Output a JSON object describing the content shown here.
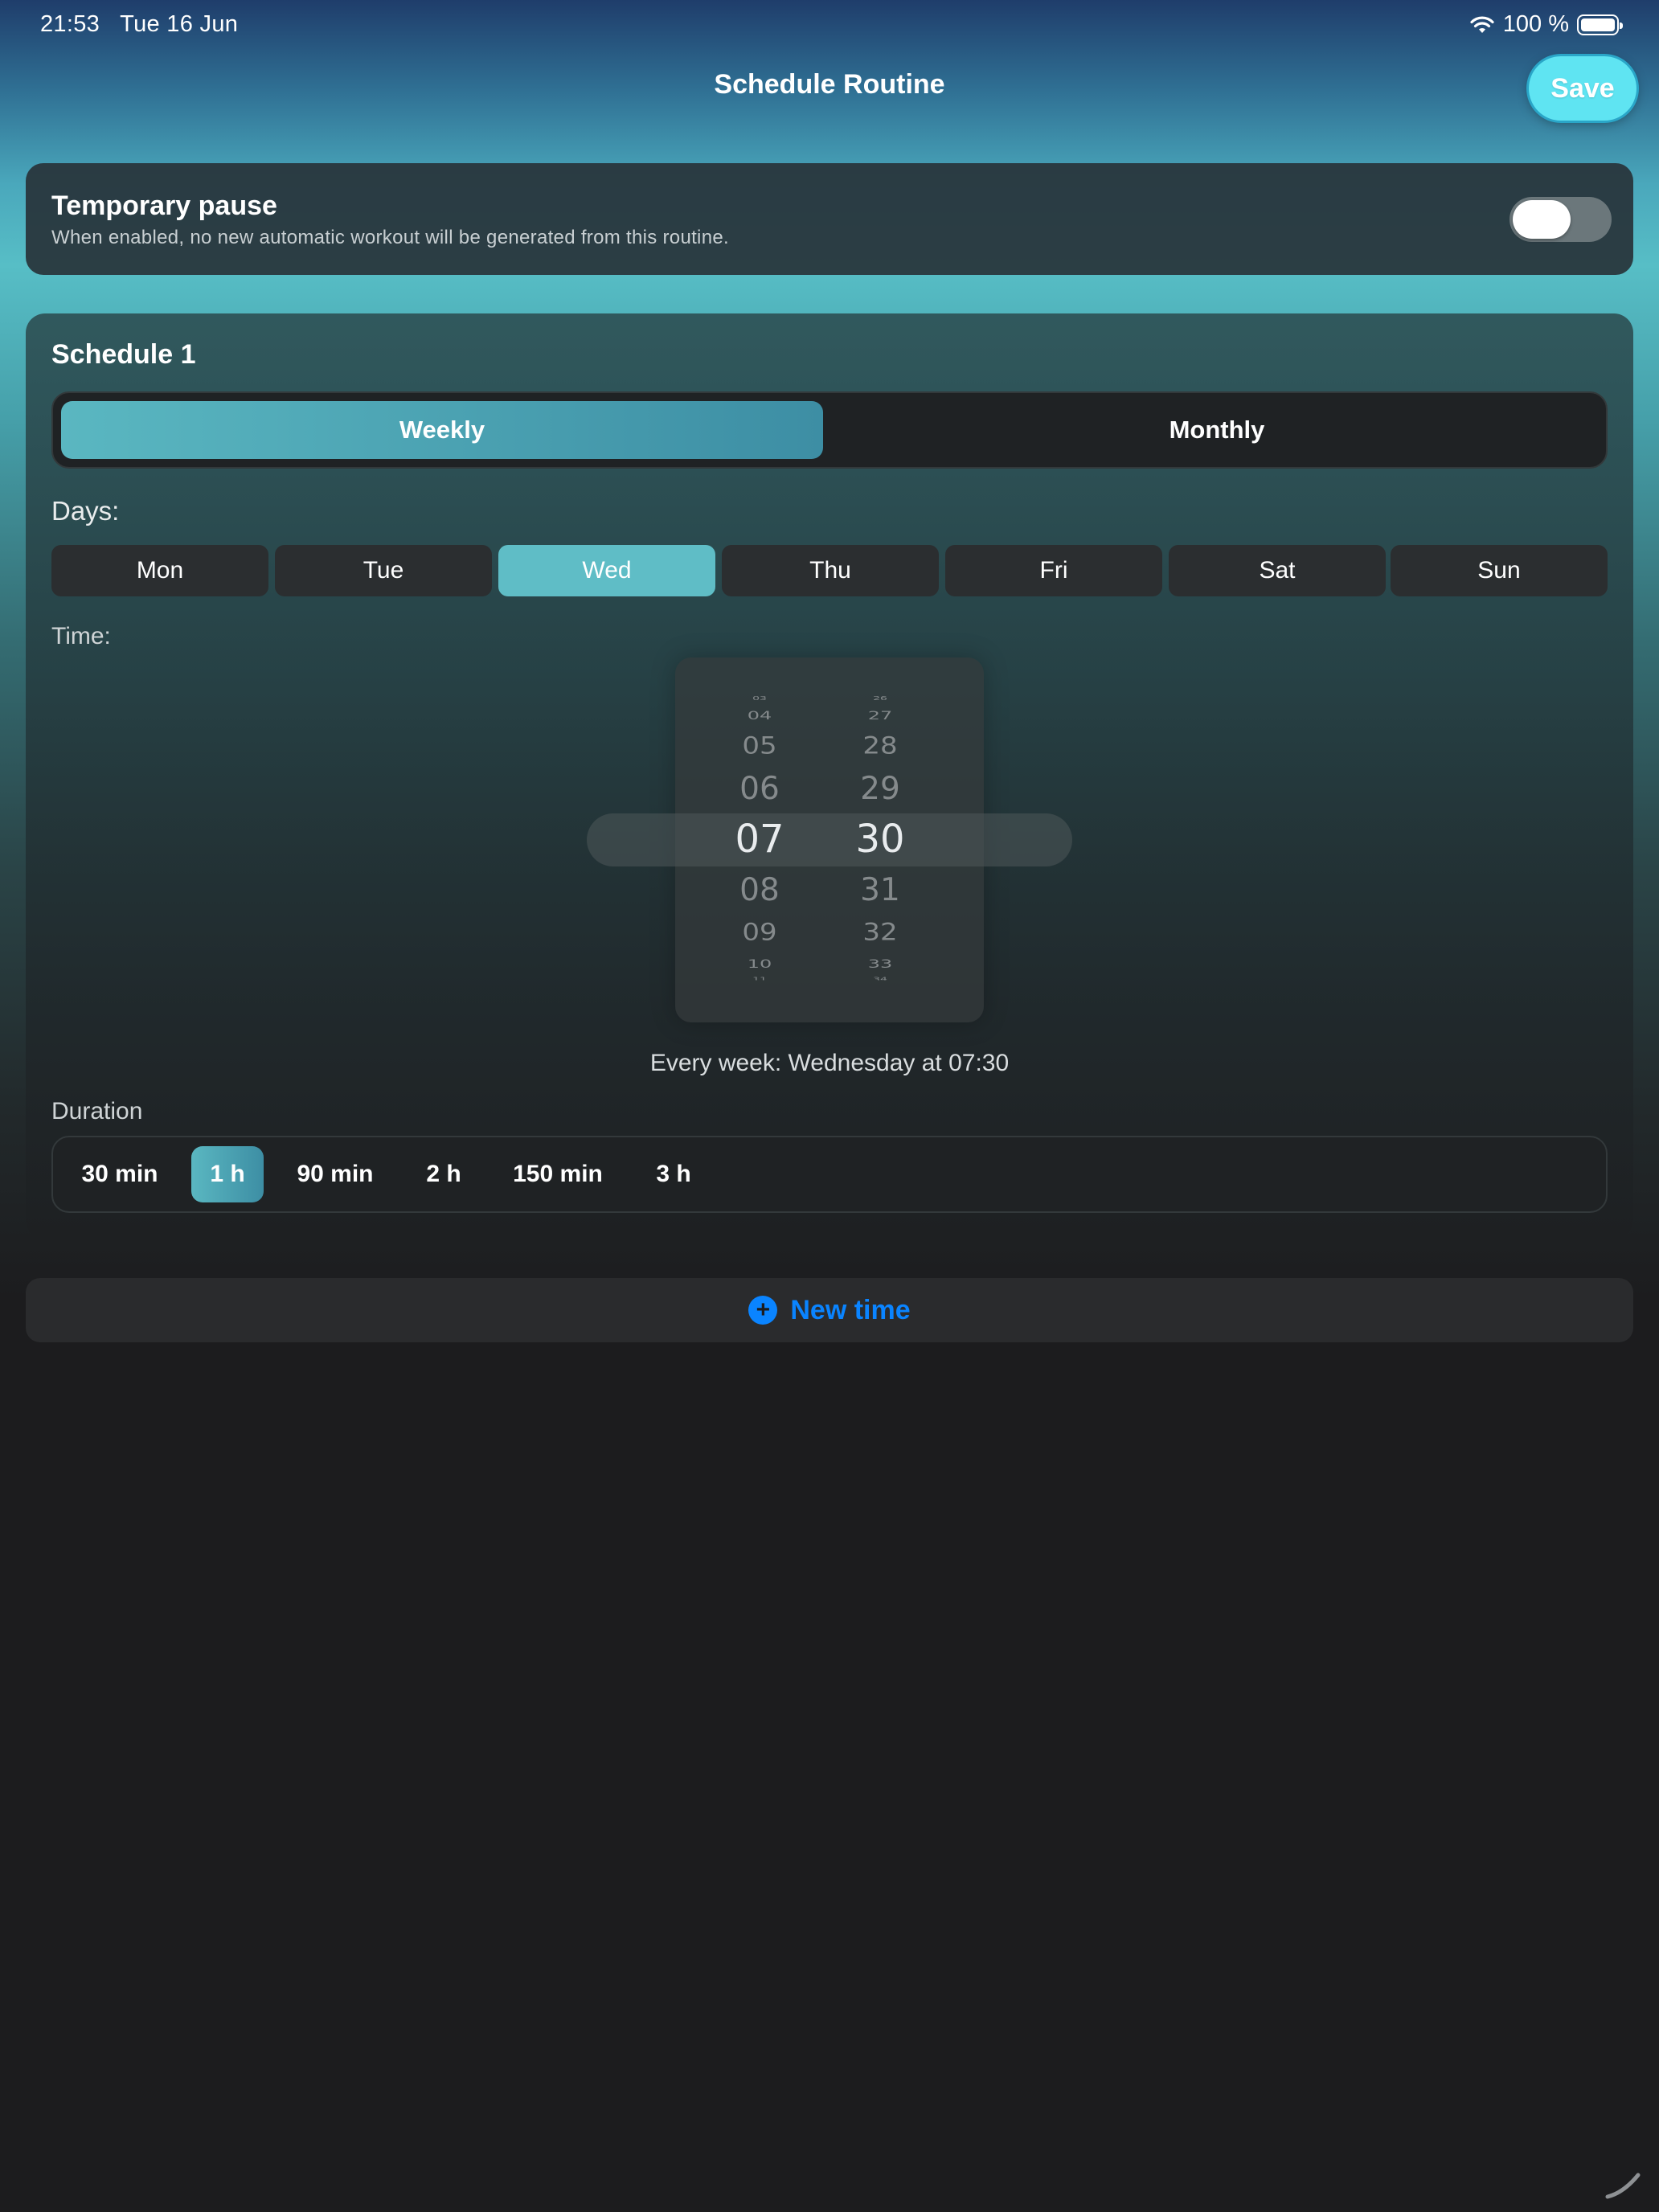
{
  "status_bar": {
    "time": "21:53",
    "date": "Tue 16 Jun",
    "battery": "100 %"
  },
  "nav": {
    "title": "Schedule Routine",
    "save_label": "Save"
  },
  "pause": {
    "title": "Temporary pause",
    "subtitle": "When enabled, no new automatic workout will be generated from this routine.",
    "enabled": false
  },
  "schedule": {
    "title": "Schedule 1",
    "modes": [
      "Weekly",
      "Monthly"
    ],
    "selected_mode": "Weekly",
    "days_label": "Days:",
    "days": [
      "Mon",
      "Tue",
      "Wed",
      "Thu",
      "Fri",
      "Sat",
      "Sun"
    ],
    "selected_day": "Wed",
    "time_label": "Time:",
    "hours": [
      "03",
      "04",
      "05",
      "06",
      "07",
      "08",
      "09",
      "10",
      "11"
    ],
    "minutes": [
      "26",
      "27",
      "28",
      "29",
      "30",
      "31",
      "32",
      "33",
      "34"
    ],
    "selected_hour": "07",
    "selected_minute": "30",
    "summary": "Every week: Wednesday at 07:30",
    "duration_label": "Duration",
    "durations": [
      "30 min",
      "1 h",
      "90 min",
      "2 h",
      "150 min",
      "3 h"
    ],
    "selected_duration": "1 h"
  },
  "new_time_label": "New time",
  "colors": {
    "accent": "#5fbdc6",
    "save": "#5fe4f2",
    "link": "#0a84ff",
    "background": "#1c1c1e"
  },
  "icons": {
    "wifi": "wifi-icon",
    "battery": "battery-icon",
    "add": "plus-circle-icon"
  }
}
